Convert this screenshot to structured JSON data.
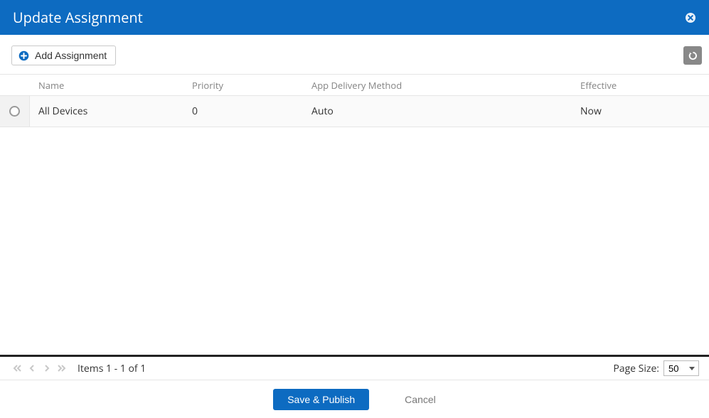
{
  "modal": {
    "title": "Update Assignment"
  },
  "toolbar": {
    "add_label": "Add Assignment"
  },
  "table": {
    "headers": {
      "name": "Name",
      "priority": "Priority",
      "method": "App Delivery Method",
      "effective": "Effective"
    },
    "rows": [
      {
        "name": "All Devices",
        "priority": "0",
        "method": "Auto",
        "effective": "Now"
      }
    ]
  },
  "pagination": {
    "status": "Items 1 - 1 of 1",
    "page_size_label": "Page Size:",
    "page_size_value": "50"
  },
  "actions": {
    "save": "Save & Publish",
    "cancel": "Cancel"
  }
}
